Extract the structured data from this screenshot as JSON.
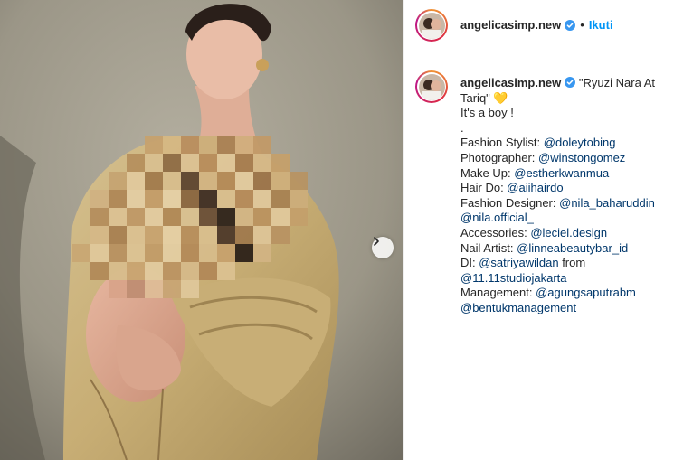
{
  "post": {
    "username": "angelicasimp.new",
    "follow_label": "Ikuti",
    "dot": "•",
    "verified_icon": "verified-badge-icon",
    "carousel_icon": "chevron-right-icon"
  },
  "caption": {
    "username": "angelicasimp.new",
    "title": "\"Ryuzi Nara At Tariq\"",
    "emoji": "💛",
    "lines": [
      "It's a boy !",
      "."
    ],
    "credits": [
      {
        "label": "Fashion Stylist: ",
        "mention": "@doleytobing"
      },
      {
        "label": "Photographer: ",
        "mention": "@winstongomez"
      },
      {
        "label": "Make Up: ",
        "mention": "@estherkwanmua"
      },
      {
        "label": "Hair Do: ",
        "mention": "@aiihairdo"
      },
      {
        "label": "Fashion Designer: ",
        "mention": "@nila_baharuddin"
      },
      {
        "label": "",
        "mention": "@nila.official_"
      },
      {
        "label": "Accessories: ",
        "mention": "@leciel.design"
      },
      {
        "label": "Nail Artist: ",
        "mention": "@linneabeautybar_id"
      },
      {
        "label": "DI: ",
        "mention": "@satriyawildan",
        "suffix": " from"
      },
      {
        "label": "",
        "mention": "@11.11studiojakarta"
      },
      {
        "label": "Management: ",
        "mention": "@agungsaputrabm"
      },
      {
        "label": "",
        "mention": "@bentukmanagement"
      }
    ]
  },
  "colors": {
    "link": "#0095f6",
    "mention": "#00376b",
    "text": "#262626",
    "verified": "#3897f0"
  }
}
